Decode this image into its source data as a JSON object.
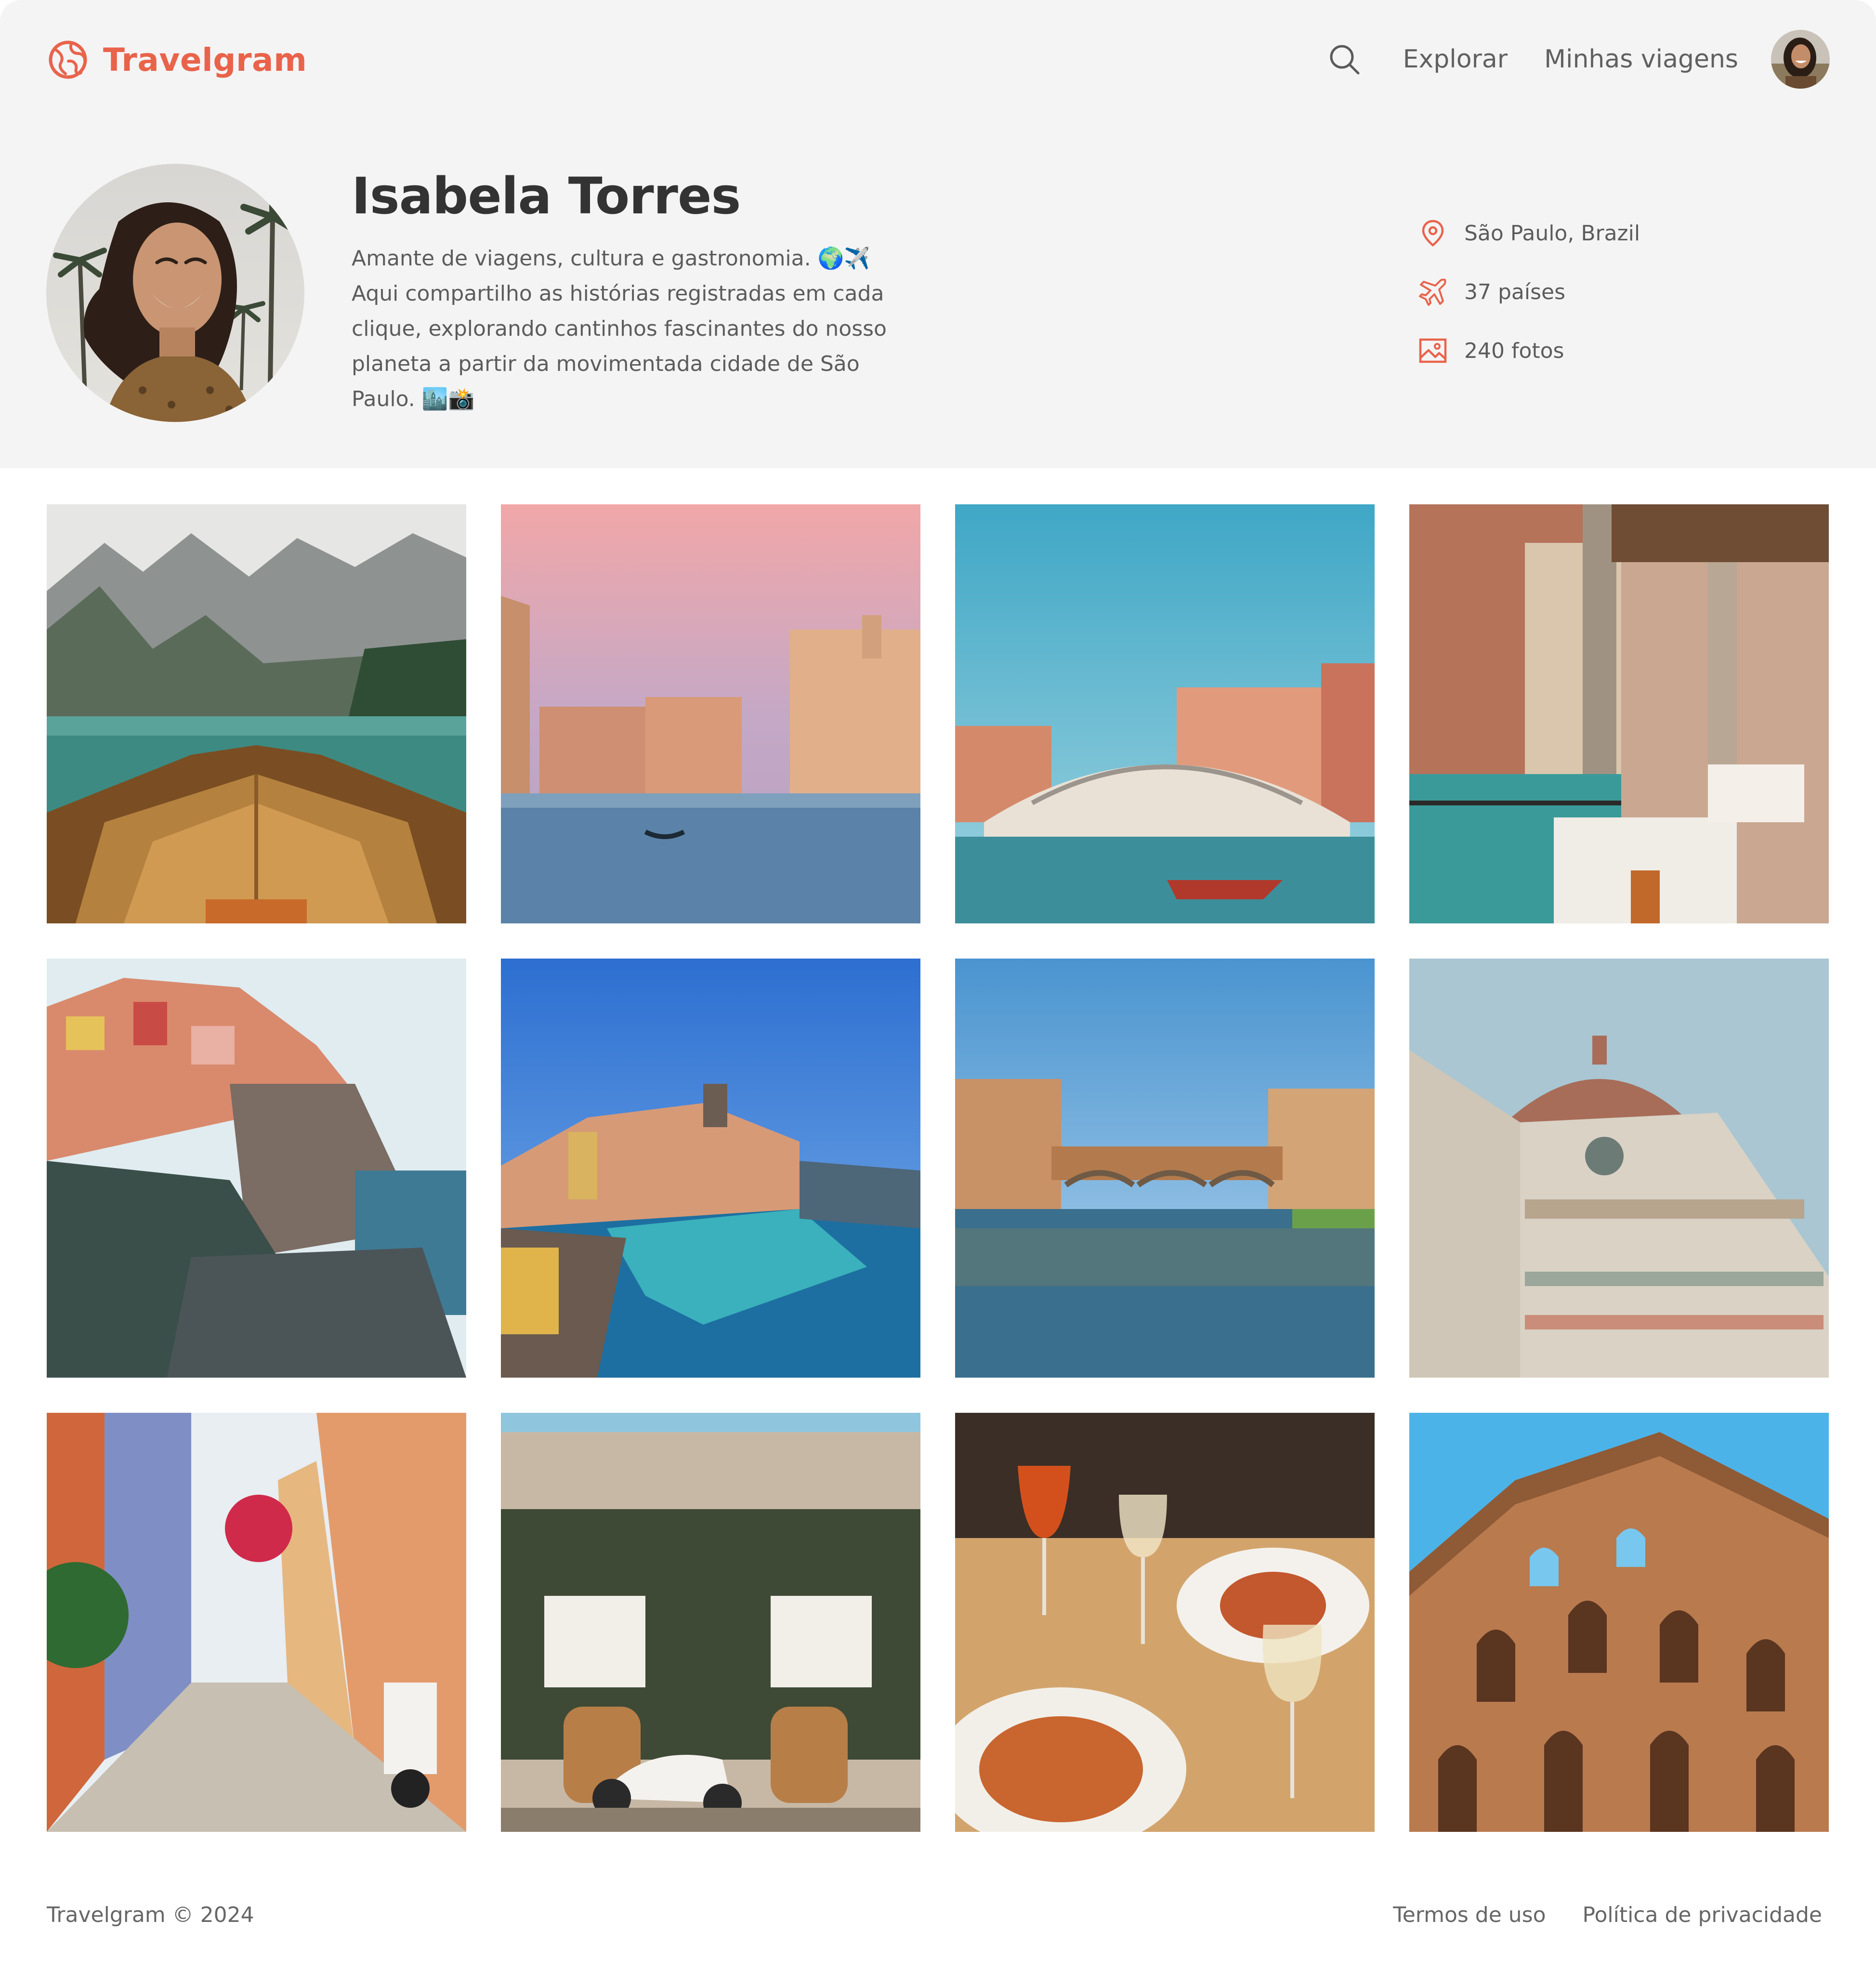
{
  "brand": {
    "name": "Travelgram",
    "icon": "globe-icon",
    "color": "#e9634b"
  },
  "nav": {
    "search_icon": "search-icon",
    "links": [
      "Explorar",
      "Minhas viagens"
    ],
    "avatar": "user-avatar"
  },
  "profile": {
    "name": "Isabela Torres",
    "bio": "Amante de viagens, cultura e gastronomia. 🌍✈️ Aqui compartilho as histórias registradas em cada clique, explorando cantinhos fascinantes do nosso planeta a partir da movimentada cidade de São Paulo. 🏙️📸",
    "stats": {
      "location": {
        "icon": "location-pin-icon",
        "text": "São Paulo, Brazil"
      },
      "countries": {
        "icon": "airplane-icon",
        "text": "37 países"
      },
      "photos": {
        "icon": "image-icon",
        "text": "240 fotos"
      }
    }
  },
  "gallery": {
    "photos": [
      "lake-boat",
      "venice-canal-sunset",
      "rialto-bridge",
      "venice-canal-cafe",
      "manarola-cliffs",
      "vernazza-harbor",
      "ponte-vecchio",
      "florence-duomo",
      "colorful-alley-vespa",
      "restaurant-vespa",
      "aperol-pasta-dinner",
      "colosseum"
    ]
  },
  "footer": {
    "copyright": "Travelgram © 2024",
    "links": [
      "Termos de uso",
      "Política de privacidade"
    ]
  },
  "colors": {
    "accent": "#e9634b",
    "band_background": "#f4f4f4",
    "text": "#333333"
  }
}
